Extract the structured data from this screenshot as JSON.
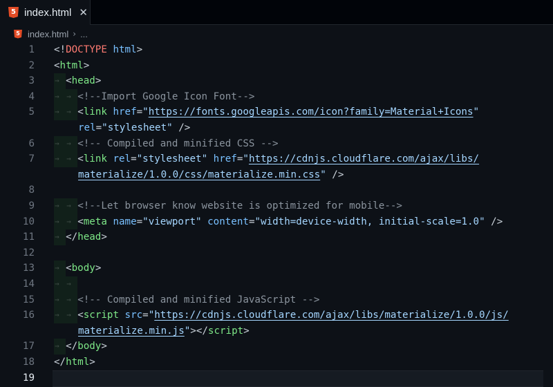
{
  "tab": {
    "icon_glyph": "5",
    "title": "index.html",
    "close_glyph": "✕"
  },
  "breadcrumb": {
    "file": "index.html",
    "separator": "›",
    "more": "..."
  },
  "editor": {
    "current_line": "19",
    "colors": {
      "background": "#0d1117",
      "tag": "#7ee787",
      "attribute": "#79c0ff",
      "string": "#a5d6ff",
      "comment": "#8b949e",
      "doctype": "#ff7b72"
    },
    "lines": [
      {
        "n": "1",
        "doctype_open": "<!",
        "doctype_kw": "DOCTYPE",
        "doctype_val": "html",
        "close": ">"
      },
      {
        "n": "2",
        "open": "<",
        "tag": "html",
        "close": ">"
      },
      {
        "n": "3",
        "open": "<",
        "tag": "head",
        "close": ">"
      },
      {
        "n": "4",
        "comment": "<!--Import Google Icon Font-->"
      },
      {
        "n": "5",
        "open": "<",
        "tag": "link",
        "attr1": "href",
        "eq": "=",
        "q": "\"",
        "url1": "https://fonts.googleapis.com/icon?family=Material+Icons",
        "q2": "\""
      },
      {
        "n": "",
        "attr2": "rel",
        "eq": "=",
        "val2": "\"stylesheet\"",
        "end": " />"
      },
      {
        "n": "6",
        "comment": "<!-- Compiled and minified CSS -->"
      },
      {
        "n": "7",
        "open": "<",
        "tag": "link",
        "attr1": "rel",
        "eq": "=",
        "val1": "\"stylesheet\"",
        "attr2": "href",
        "q": "\"",
        "url1": "https://cdnjs.cloudflare.com/ajax/libs/"
      },
      {
        "n": "",
        "url2": "materialize/1.0.0/css/materialize.min.css",
        "q2": "\"",
        "end": " />"
      },
      {
        "n": "8"
      },
      {
        "n": "9",
        "comment": "<!--Let browser know website is optimized for mobile-->"
      },
      {
        "n": "10",
        "open": "<",
        "tag": "meta",
        "attr1": "name",
        "eq": "=",
        "val1": "\"viewport\"",
        "attr2": "content",
        "val2": "\"width=device-width, initial-scale=1.0\"",
        "end": " />"
      },
      {
        "n": "11",
        "open": "</",
        "tag": "head",
        "close": ">"
      },
      {
        "n": "12"
      },
      {
        "n": "13",
        "open": "<",
        "tag": "body",
        "close": ">"
      },
      {
        "n": "14"
      },
      {
        "n": "15",
        "comment": "<!-- Compiled and minified JavaScript -->"
      },
      {
        "n": "16",
        "open": "<",
        "tag": "script",
        "attr1": "src",
        "eq": "=",
        "q": "\"",
        "url1": "https://cdnjs.cloudflare.com/ajax/libs/materialize/1.0.0/js/"
      },
      {
        "n": "",
        "url2": "materialize.min.js",
        "q2": "\"",
        "mid": "></",
        "tag2": "script",
        "close": ">"
      },
      {
        "n": "17",
        "open": "</",
        "tag": "body",
        "close": ">"
      },
      {
        "n": "18",
        "open": "</",
        "tag": "html",
        "close": ">"
      },
      {
        "n": "19"
      }
    ]
  }
}
